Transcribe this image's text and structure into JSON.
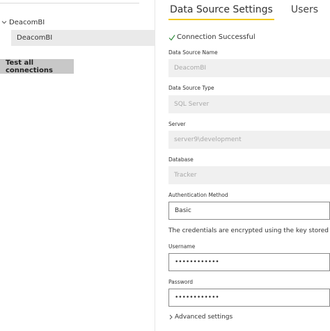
{
  "sidebar": {
    "root_label": "DeacomBI",
    "root_icon": "chevron-down-icon",
    "items": [
      {
        "label": "DeacomBI"
      }
    ],
    "test_button_label": "Test all connections"
  },
  "tabs": [
    {
      "label": "Data Source Settings",
      "active": true
    },
    {
      "label": "Users",
      "active": false
    }
  ],
  "status": {
    "icon": "checkmark-icon",
    "text": "Connection Successful",
    "color": "#2e8b3a"
  },
  "form": {
    "data_source_name": {
      "label": "Data Source Name",
      "value": "DeacomBI"
    },
    "data_source_type": {
      "label": "Data Source Type",
      "value": "SQL Server"
    },
    "server": {
      "label": "Server",
      "value": "server9\\development"
    },
    "database": {
      "label": "Database",
      "value": "Tracker"
    },
    "auth_method": {
      "label": "Authentication Method",
      "value": "Basic"
    },
    "credentials_note": "The credentials are encrypted using the key stored on-p",
    "username": {
      "label": "Username",
      "value": "••••••••••••"
    },
    "password": {
      "label": "Password",
      "value": "••••••••••••"
    },
    "advanced_label": "Advanced settings"
  },
  "colors": {
    "tab_accent": "#f2c811",
    "selected_item_bg": "#eaeaea",
    "button_bg": "#c8c8c8"
  }
}
